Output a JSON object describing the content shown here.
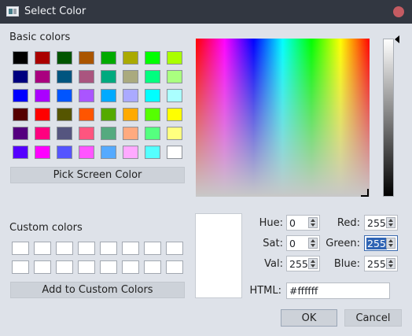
{
  "window": {
    "title": "Select Color"
  },
  "basic_colors": {
    "label": "Basic colors",
    "swatches": [
      "#000000",
      "#aa0000",
      "#005500",
      "#aa5500",
      "#00aa00",
      "#aaaa00",
      "#00ff00",
      "#aaff00",
      "#00007f",
      "#aa007f",
      "#00557f",
      "#aa557f",
      "#00aa7f",
      "#aaaa7f",
      "#00ff7f",
      "#aaff7f",
      "#0000ff",
      "#aa00ff",
      "#0055ff",
      "#aa55ff",
      "#00aaff",
      "#aaaaff",
      "#00ffff",
      "#aaffff",
      "#550000",
      "#ff0000",
      "#555500",
      "#ff5500",
      "#55aa00",
      "#ffaa00",
      "#55ff00",
      "#ffff00",
      "#55007f",
      "#ff007f",
      "#55557f",
      "#ff557f",
      "#55aa7f",
      "#ffaa7f",
      "#55ff7f",
      "#ffff7f",
      "#5500ff",
      "#ff00ff",
      "#5555ff",
      "#ff55ff",
      "#55aaff",
      "#ffaaff",
      "#55ffff",
      "#ffffff"
    ]
  },
  "pick_screen_label": "Pick Screen Color",
  "custom_colors": {
    "label": "Custom colors",
    "swatches": [
      "#ffffff",
      "#ffffff",
      "#ffffff",
      "#ffffff",
      "#ffffff",
      "#ffffff",
      "#ffffff",
      "#ffffff",
      "#ffffff",
      "#ffffff",
      "#ffffff",
      "#ffffff",
      "#ffffff",
      "#ffffff",
      "#ffffff",
      "#ffffff"
    ]
  },
  "add_custom_label": "Add to Custom Colors",
  "fields": {
    "hue": {
      "label": "Hue:",
      "value": "0"
    },
    "sat": {
      "label": "Sat:",
      "value": "0"
    },
    "val": {
      "label": "Val:",
      "value": "255"
    },
    "red": {
      "label": "Red:",
      "value": "255"
    },
    "green": {
      "label": "Green:",
      "value": "255"
    },
    "blue": {
      "label": "Blue:",
      "value": "255"
    }
  },
  "html": {
    "label": "HTML:",
    "value": "#ffffff"
  },
  "current_color": "#ffffff",
  "buttons": {
    "ok": "OK",
    "cancel": "Cancel"
  }
}
